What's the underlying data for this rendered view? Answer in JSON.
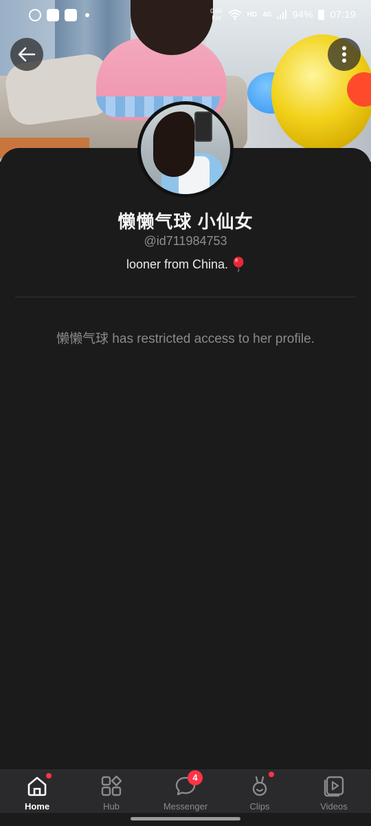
{
  "status_bar": {
    "speed_value": "0.66",
    "speed_unit": "K/s",
    "hd": "HD",
    "network": "4G",
    "battery": "94%",
    "time": "07:19"
  },
  "profile": {
    "name": "懒懒气球 小仙女",
    "handle": "@id711984753",
    "bio": "looner from China.",
    "restricted_message": "懒懒气球 has restricted access to her profile."
  },
  "bottom_nav": {
    "items": [
      {
        "label": "Home",
        "icon": "home-icon",
        "active": true,
        "dot": true
      },
      {
        "label": "Hub",
        "icon": "hub-icon",
        "active": false,
        "dot": false
      },
      {
        "label": "Messenger",
        "icon": "messenger-icon",
        "active": false,
        "badge": "4"
      },
      {
        "label": "Clips",
        "icon": "clips-icon",
        "active": false,
        "dot": true
      },
      {
        "label": "Videos",
        "icon": "videos-icon",
        "active": false,
        "dot": false
      }
    ]
  },
  "colors": {
    "background": "#1b1b1c",
    "accent_red": "#ff3347",
    "nav_bg": "#2a2a2c"
  }
}
